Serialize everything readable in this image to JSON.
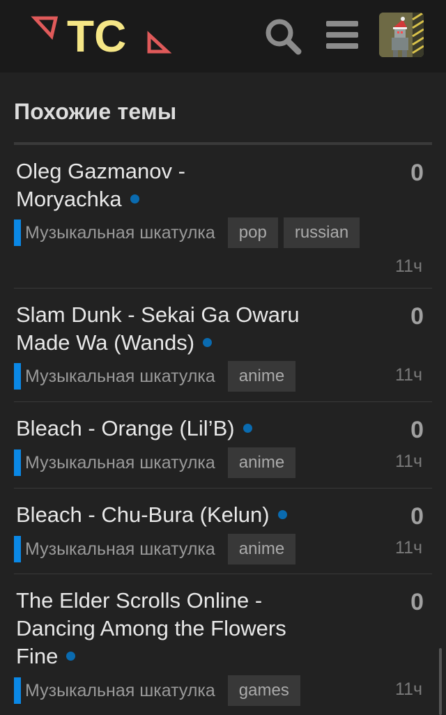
{
  "header": {
    "logo_text": "TC",
    "accent_color": "#e05a5a",
    "logo_color": "#f5e686"
  },
  "section": {
    "title": "Похожие темы"
  },
  "topics": [
    {
      "title_line1": "Oleg Gazmanov -",
      "title_line2": "Moryachka",
      "replies": "0",
      "category": "Музыкальная шкатулка",
      "tags": [
        "pop",
        "russian"
      ],
      "age": "11ч"
    },
    {
      "title_line1": "Slam Dunk - Sekai Ga Owaru",
      "title_line2": "Made Wa (Wands)",
      "replies": "0",
      "category": "Музыкальная шкатулка",
      "tags": [
        "anime"
      ],
      "age": "11ч"
    },
    {
      "title_line1": "Bleach - Orange (Lil’B)",
      "replies": "0",
      "category": "Музыкальная шкатулка",
      "tags": [
        "anime"
      ],
      "age": "11ч"
    },
    {
      "title_line1": "Bleach - Chu-Bura (Kelun)",
      "replies": "0",
      "category": "Музыкальная шкатулка",
      "tags": [
        "anime"
      ],
      "age": "11ч"
    },
    {
      "title_line1": "The Elder Scrolls Online -",
      "title_line2": "Dancing Among the Flowers",
      "title_line3": "Fine",
      "replies": "0",
      "category": "Музыкальная шкатулка",
      "tags": [
        "games"
      ],
      "age": "11ч"
    }
  ],
  "colors": {
    "background": "#222222",
    "header_background": "#1a1a1a",
    "category_color": "#0a88e6",
    "unread_dot": "#0a6bb0"
  },
  "icons": {
    "search": "search-icon",
    "menu": "hamburger-menu-icon",
    "avatar": "user-avatar"
  }
}
